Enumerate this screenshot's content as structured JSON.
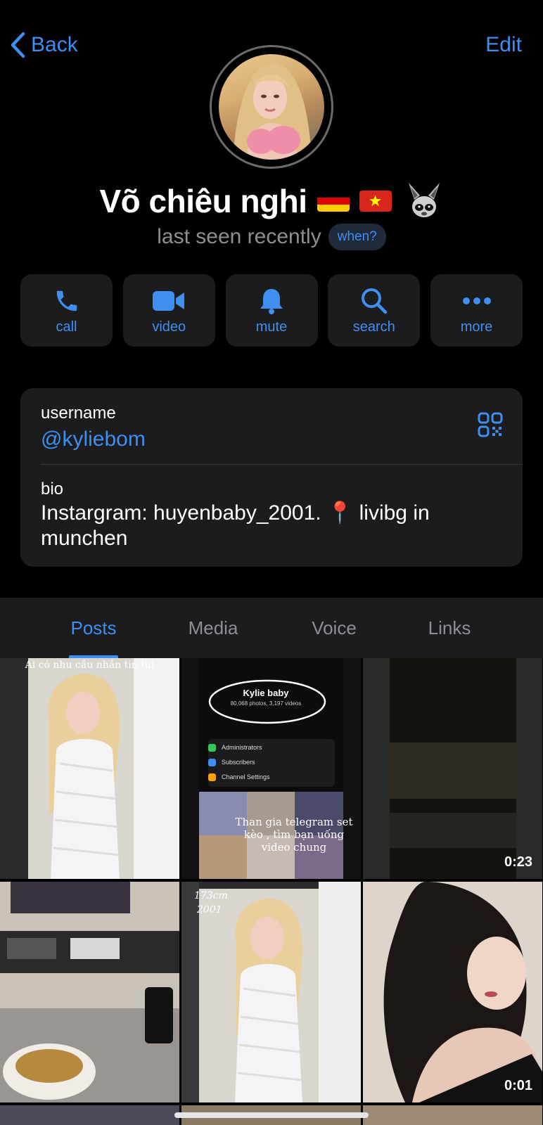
{
  "header": {
    "back_label": "Back",
    "edit_label": "Edit"
  },
  "profile": {
    "name": "Võ chiêu nghi",
    "status": "last seen recently",
    "when_label": "when?"
  },
  "actions": [
    {
      "label": "call",
      "icon": "phone-icon"
    },
    {
      "label": "video",
      "icon": "video-camera-icon"
    },
    {
      "label": "mute",
      "icon": "bell-icon"
    },
    {
      "label": "search",
      "icon": "search-icon"
    },
    {
      "label": "more",
      "icon": "ellipsis-icon"
    }
  ],
  "info": {
    "username_label": "username",
    "username": "@kyliebom",
    "bio_label": "bio",
    "bio": "Instargram: huyenbaby_2001. 📍 livibg in munchen"
  },
  "tabs": [
    {
      "label": "Posts",
      "active": true
    },
    {
      "label": "Media",
      "active": false
    },
    {
      "label": "Voice",
      "active": false
    },
    {
      "label": "Links",
      "active": false
    }
  ],
  "media": {
    "cells": [
      {
        "caption": "Ai có nhu cầu nhắn tin tui"
      },
      {
        "mini_title": "Kylie baby",
        "mini_sub": "80,068 photos, 3,197 videos",
        "rows": [
          "Administrators",
          "Subscribers",
          "Channel Settings"
        ],
        "caption": "Than gia telegram set kèo , tìm bạn uống video chung"
      },
      {
        "duration": "0:23"
      },
      {},
      {
        "overlay1": "173cm",
        "overlay2": "2001"
      },
      {
        "duration": "0:01"
      }
    ]
  },
  "colors": {
    "accent": "#3e8ff0",
    "card": "#1c1c1e",
    "background": "#000000",
    "secondary_text": "#8e8e93"
  }
}
